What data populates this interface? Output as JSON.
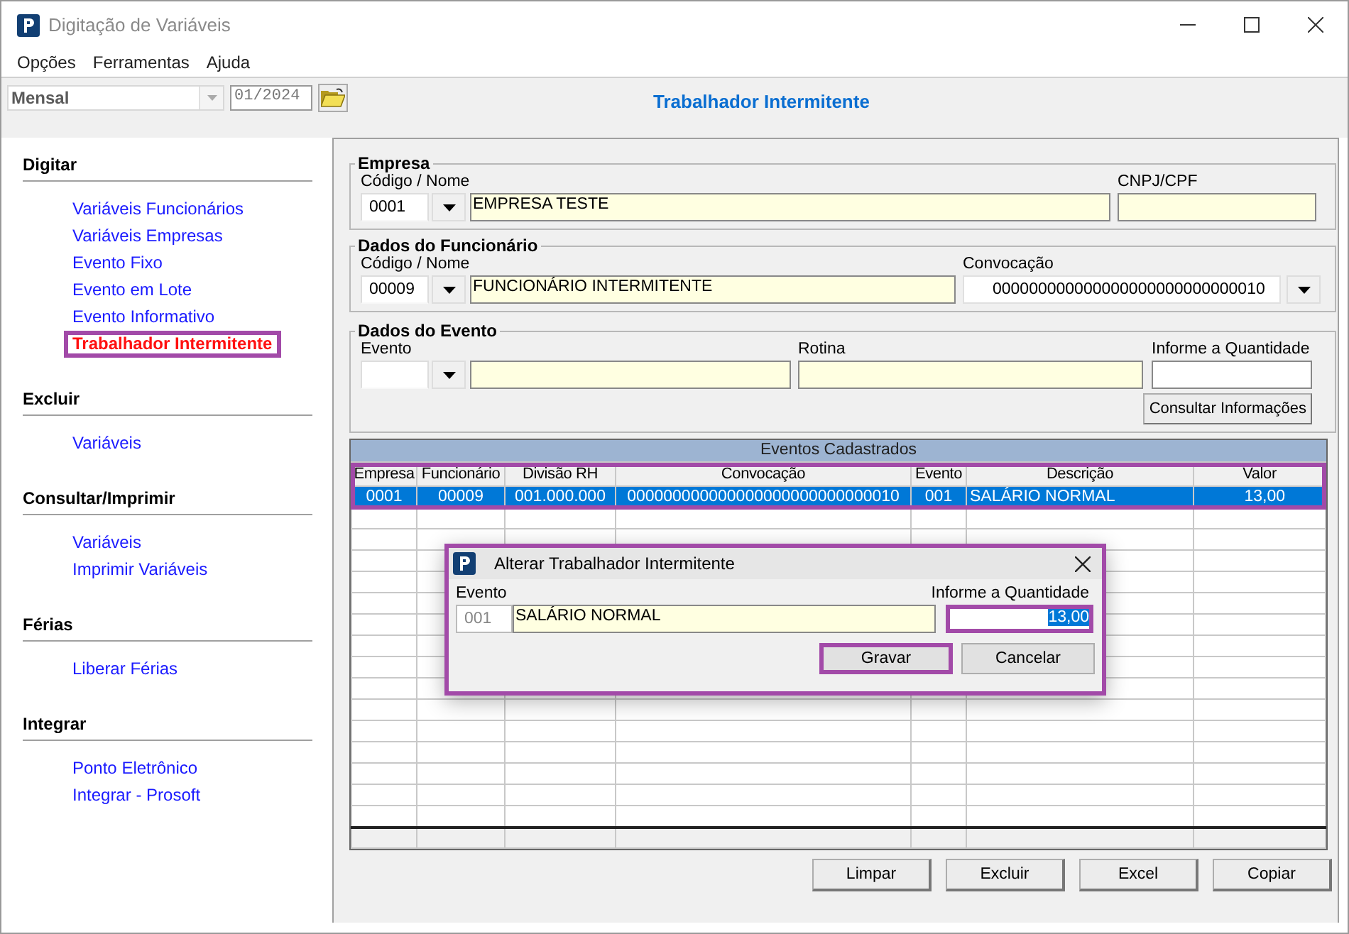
{
  "window": {
    "title": "Digitação de Variáveis"
  },
  "menu": [
    "Opções",
    "Ferramentas",
    "Ajuda"
  ],
  "toolbar": {
    "period": "Mensal",
    "competence": "01/2024"
  },
  "page_title": "Trabalhador Intermitente",
  "sidebar": [
    {
      "title": "Digitar",
      "items": [
        {
          "label": "Variáveis Funcionários",
          "selected": false,
          "highlighted": false
        },
        {
          "label": "Variáveis Empresas",
          "selected": false,
          "highlighted": false
        },
        {
          "label": "Evento Fixo",
          "selected": false,
          "highlighted": false
        },
        {
          "label": "Evento em Lote",
          "selected": false,
          "highlighted": false
        },
        {
          "label": "Evento Informativo",
          "selected": false,
          "highlighted": false
        },
        {
          "label": "Trabalhador Intermitente",
          "selected": true,
          "highlighted": true
        }
      ]
    },
    {
      "title": "Excluir",
      "items": [
        {
          "label": "Variáveis",
          "selected": false,
          "highlighted": false
        }
      ]
    },
    {
      "title": "Consultar/Imprimir",
      "items": [
        {
          "label": "Variáveis",
          "selected": false,
          "highlighted": false
        },
        {
          "label": "Imprimir Variáveis",
          "selected": false,
          "highlighted": false
        }
      ]
    },
    {
      "title": "Férias",
      "items": [
        {
          "label": "Liberar Férias",
          "selected": false,
          "highlighted": false
        }
      ]
    },
    {
      "title": "Integrar",
      "items": [
        {
          "label": "Ponto Eletrônico",
          "selected": false,
          "highlighted": false
        },
        {
          "label": "Integrar - Prosoft",
          "selected": false,
          "highlighted": false
        }
      ]
    }
  ],
  "empresa": {
    "title": "Empresa",
    "code_label": "Código / Nome",
    "code": "0001",
    "name": "EMPRESA TESTE",
    "cnpj_label": "CNPJ/CPF"
  },
  "funcionario": {
    "title": "Dados do Funcionário",
    "code_label": "Código / Nome",
    "code": "00009",
    "name": "FUNCIONÁRIO INTERMITENTE",
    "convocacao_label": "Convocação",
    "convocacao": "000000000000000000000000000010"
  },
  "evento": {
    "title": "Dados do Evento",
    "evento_label": "Evento",
    "rotina_label": "Rotina",
    "qty_label": "Informe a Quantidade",
    "button": "Consultar Informações"
  },
  "table": {
    "title": "Eventos Cadastrados",
    "highlighted": true,
    "columns": [
      "Empresa",
      "Funcionário",
      "Divisão RH",
      "Convocação",
      "Evento",
      "Descrição",
      "Valor"
    ],
    "rows": [
      {
        "cells": [
          "0001",
          "00009",
          "001.000.000",
          "000000000000000000000000000010",
          "001",
          "SALÁRIO NORMAL",
          "13,00"
        ],
        "selected": true
      }
    ]
  },
  "dialog": {
    "title": "Alterar Trabalhador Intermitente",
    "highlighted": true,
    "evento_label": "Evento",
    "evento_code": "001",
    "evento_name": "SALÁRIO NORMAL",
    "qty_label": "Informe a Quantidade",
    "qty": "13,00",
    "qty_highlighted": true,
    "qty_text_selected": true,
    "buttons": [
      {
        "label": "Gravar",
        "highlighted": true
      },
      {
        "label": "Cancelar",
        "highlighted": false
      }
    ]
  },
  "buttons": [
    "Limpar",
    "Excluir",
    "Excel",
    "Copiar"
  ]
}
